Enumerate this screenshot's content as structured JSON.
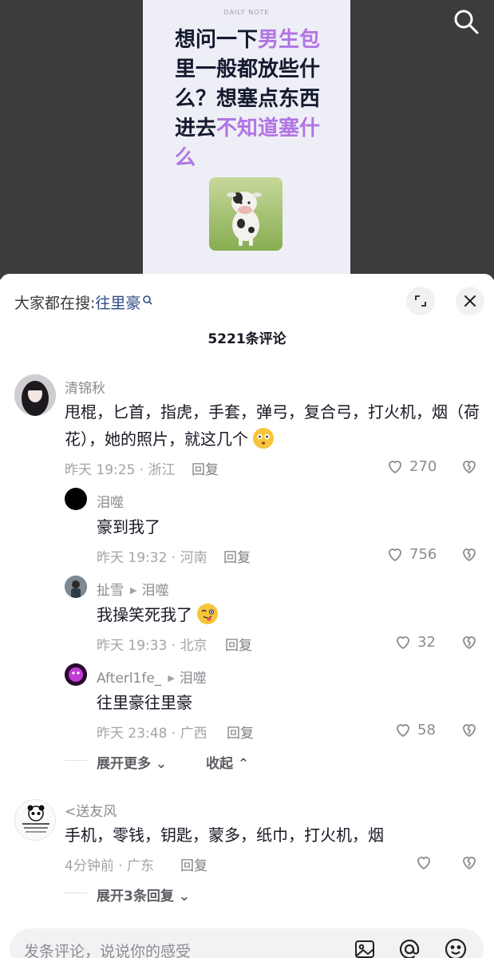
{
  "video": {
    "poster_label": "DAILY NOTE",
    "headline_parts": [
      {
        "text": "想问一下",
        "hl": false
      },
      {
        "text": "男生包",
        "hl": true
      },
      {
        "text": "里一般都放些什么？想塞点东西进去",
        "hl": false
      },
      {
        "text": "不知道塞什么",
        "hl": true
      }
    ],
    "search_icon": "search-icon"
  },
  "panel": {
    "hot_search_prefix": "大家都在搜:",
    "hot_search_keyword": "往里豪",
    "comment_count_title": "5221条评论"
  },
  "comments": [
    {
      "user": "清锦秋",
      "text": "甩棍，匕首，指虎，手套，弹弓，复合弓，打火机，烟（荷花），她的照片，就这几个",
      "time_location": "昨天 19:25 · 浙江",
      "reply_label": "回复",
      "likes": "270"
    }
  ],
  "replies": [
    {
      "user": "泪噬",
      "text": "豪到我了",
      "time_location": "昨天 19:32 · 河南",
      "reply_label": "回复",
      "likes": "756"
    },
    {
      "user": "扯雪",
      "reply_to": "泪噬",
      "text": "我操笑死我了",
      "time_location": "昨天 19:33 · 北京",
      "reply_label": "回复",
      "likes": "32"
    },
    {
      "user": "Afterl1fe_",
      "reply_to": "泪噬",
      "text": "往里豪往里豪",
      "time_location": "昨天 23:48 · 广西",
      "reply_label": "回复",
      "likes": "58"
    }
  ],
  "thread_controls": {
    "expand_more": "展开更多",
    "collapse": "收起"
  },
  "comment2": {
    "user": "<送友风",
    "text": "手机，零钱，钥匙，蒙多，纸巾，打火机，烟",
    "time_location": "4分钟前 · 广东",
    "reply_label": "回复",
    "expand_replies": "展开3条回复"
  },
  "input": {
    "placeholder": "发条评论，说说你的感受"
  },
  "colors": {
    "highlight_purple": "#b274e4",
    "keyword_blue": "#2b4b83",
    "text_primary": "#161823",
    "text_secondary": "#8a8b91"
  }
}
